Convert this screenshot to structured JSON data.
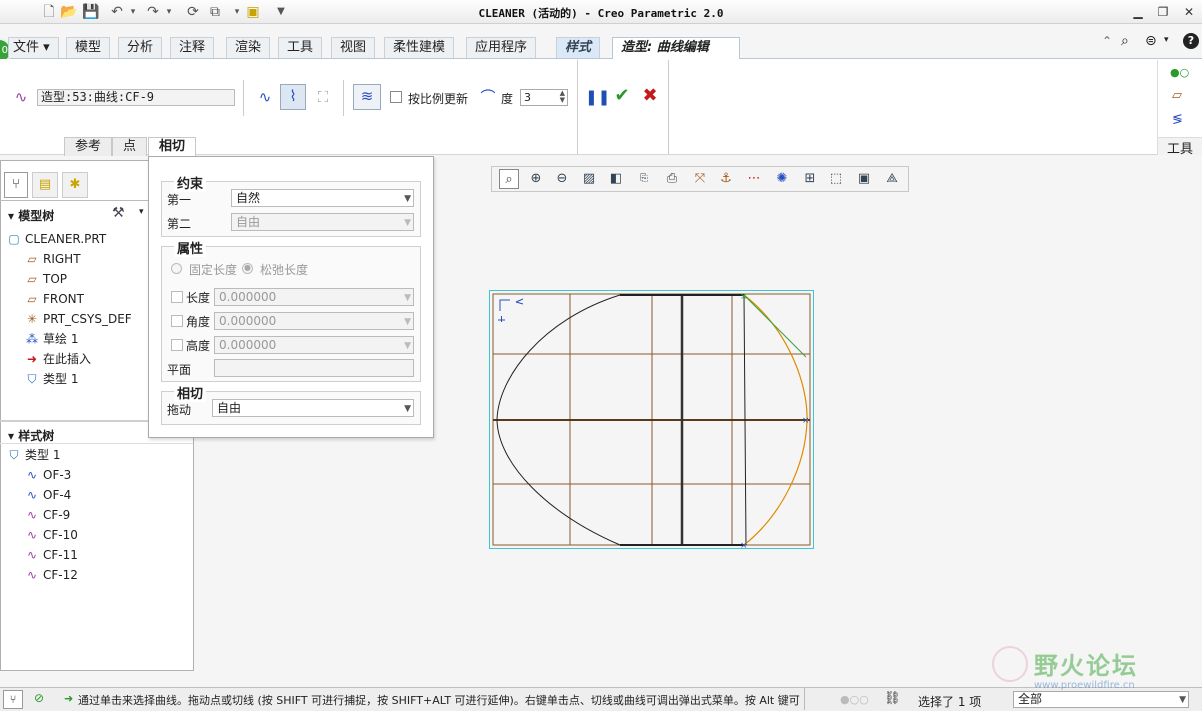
{
  "window": {
    "title": "CLEANER (活动的) - Creo Parametric 2.0"
  },
  "ribbon": {
    "tabs": [
      "文件",
      "模型",
      "分析",
      "注释",
      "渲染",
      "工具",
      "视图",
      "柔性建模",
      "应用程序",
      "样式",
      "造型: 曲线编辑"
    ],
    "curve_name": "造型:53:曲线:CF-9",
    "proportional_update_label": "按比例更新",
    "degree_label": "度",
    "degree_value": "3",
    "subtabs": [
      "参考",
      "点",
      "相切"
    ]
  },
  "tools_panel": {
    "label": "工具"
  },
  "tangent_panel": {
    "constraint_title": "约束",
    "first_label": "第一",
    "first_value": "自然",
    "second_label": "第二",
    "second_value": "自由",
    "properties_title": "属性",
    "fixed_length": "固定长度",
    "relaxed_length": "松弛长度",
    "length_label": "长度",
    "length_value": "0.000000",
    "angle_label": "角度",
    "angle_value": "0.000000",
    "height_label": "高度",
    "height_value": "0.000000",
    "plane_label": "平面",
    "tangent_title": "相切",
    "drag_label": "拖动",
    "drag_value": "自由"
  },
  "model_tree": {
    "title": "模型树",
    "items": [
      "CLEANER.PRT",
      "RIGHT",
      "TOP",
      "FRONT",
      "PRT_CSYS_DEF",
      "草绘 1",
      "在此插入",
      "类型 1"
    ]
  },
  "style_tree": {
    "title": "样式树",
    "items": [
      "类型 1",
      "OF-3",
      "OF-4",
      "CF-9",
      "CF-10",
      "CF-11",
      "CF-12"
    ]
  },
  "status": {
    "message": "通过单击来选择曲线。拖动点或切线 (按 SHIFT 可进行捕捉，按 SHIFT+ALT 可进行延伸)。右键单击点、切线或曲线可调出弹出式菜单。按 Alt 键可",
    "selection": "选择了 1 项",
    "filter": "全部"
  },
  "watermark": {
    "text": "野火论坛",
    "url": "www.proewildfire.cn"
  },
  "colors": {
    "accent": "#3c7fc1",
    "grid": "#8b5a2b",
    "confirm": "#2a9a2a",
    "cancel": "#c41a1a",
    "curve_orange": "#e08a00"
  }
}
